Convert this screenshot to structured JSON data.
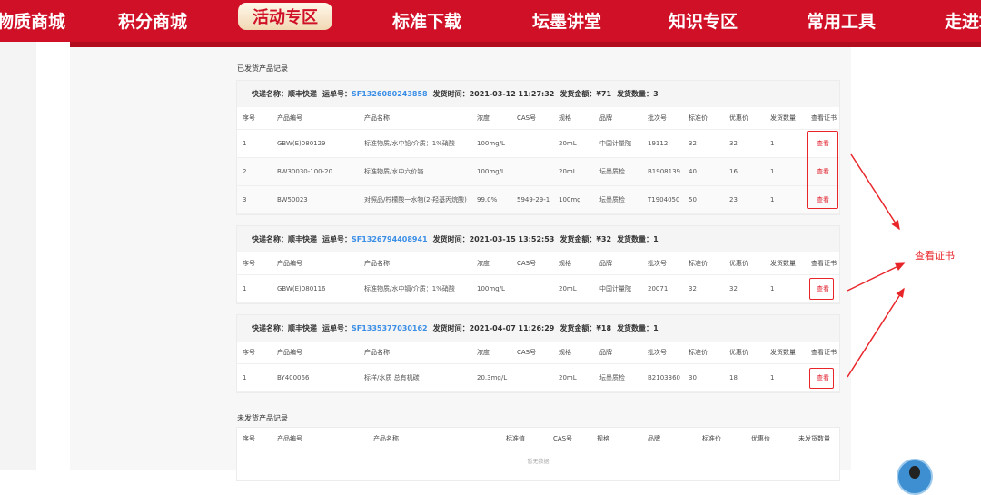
{
  "nav": {
    "items": [
      "物质商城",
      "积分商城",
      "活动专区",
      "标准下载",
      "坛墨讲堂",
      "知识专区",
      "常用工具",
      "走进坛墨"
    ],
    "active": 2
  },
  "shipped": {
    "title": "已发货产品记录",
    "columns": [
      "序号",
      "产品编号",
      "产品名称",
      "浓度",
      "CAS号",
      "规格",
      "品牌",
      "批次号",
      "标准价",
      "优惠价",
      "发货数量",
      "查看证书"
    ],
    "labels": {
      "courier": "快递名称：",
      "waybill": "运单号：",
      "time": "发货时间：",
      "amount": "发货金额：",
      "qty": "发货数量："
    },
    "view_label": "查看",
    "orders": [
      {
        "courier": "顺丰快递",
        "waybill": "SF1326080243858",
        "time": "2021-03-12 11:27:32",
        "amount": "¥71",
        "qty": "3",
        "rows": [
          [
            "1",
            "GBW(E)080129",
            "标准物质/水中铅/介质：1%硝酸",
            "100mg/L",
            "",
            "20mL",
            "中国计量院",
            "19112",
            "32",
            "32",
            "1"
          ],
          [
            "2",
            "BW30030-100-20",
            "标准物质/水中六价铬",
            "100mg/L",
            "",
            "20mL",
            "坛墨质检",
            "B1908139",
            "40",
            "16",
            "1"
          ],
          [
            "3",
            "BW50023",
            "对照品/柠檬酸一水物(2-羟基丙烷酸)",
            "99.0%",
            "5949-29-1",
            "100mg",
            "坛墨质检",
            "T1904050",
            "50",
            "23",
            "1"
          ]
        ]
      },
      {
        "courier": "顺丰快递",
        "waybill": "SF1326794408941",
        "time": "2021-03-15 13:52:53",
        "amount": "¥32",
        "qty": "1",
        "rows": [
          [
            "1",
            "GBW(E)080116",
            "标准物质/水中镉/介质：1%硝酸",
            "100mg/L",
            "",
            "20mL",
            "中国计量院",
            "20071",
            "32",
            "32",
            "1"
          ]
        ]
      },
      {
        "courier": "顺丰快递",
        "waybill": "SF1335377030162",
        "time": "2021-04-07 11:26:29",
        "amount": "¥18",
        "qty": "1",
        "rows": [
          [
            "1",
            "BY400066",
            "标样/水质 总有机碳",
            "20.3mg/L",
            "",
            "20mL",
            "坛墨质检",
            "B2103360",
            "30",
            "18",
            "1"
          ]
        ]
      }
    ]
  },
  "unshipped": {
    "title": "未发货产品记录",
    "columns": [
      "序号",
      "产品编号",
      "产品名称",
      "标准值",
      "CAS号",
      "规格",
      "品牌",
      "标准价",
      "优惠价",
      "未发货数量"
    ],
    "empty": "暂无数据"
  },
  "annotation": {
    "label": "查看证书",
    "color": "#e8262a"
  }
}
